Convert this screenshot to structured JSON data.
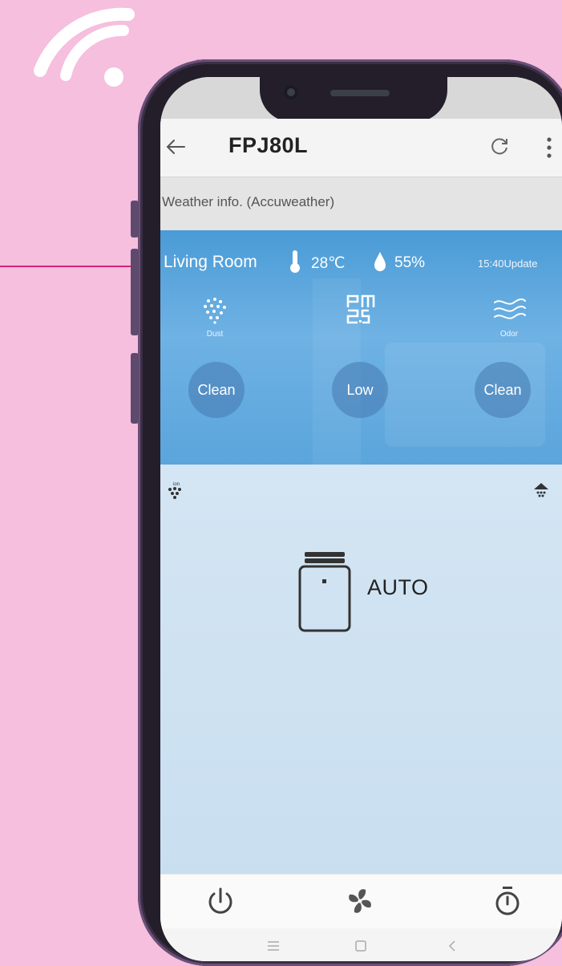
{
  "app": {
    "title": "FPJ80L"
  },
  "weather": {
    "source_label": "Weather info. (Accuweather)"
  },
  "status": {
    "room": "Living Room",
    "temperature": "28℃",
    "humidity": "55%",
    "update": "15:40Update"
  },
  "sensors": [
    {
      "caption": "Dust",
      "level": "Clean",
      "icon": "dust-icon"
    },
    {
      "caption": "",
      "level": "Low",
      "icon": "pm25-icon"
    },
    {
      "caption": "Odor",
      "level": "Clean",
      "icon": "odor-icon"
    }
  ],
  "mode": {
    "label": "AUTO",
    "ion_tag": "ion"
  },
  "controls": [
    "power-icon",
    "fan-icon",
    "timer-icon"
  ],
  "nav": [
    "menu-icon",
    "home-icon",
    "back-icon"
  ],
  "colors": {
    "background": "#f5bfdd",
    "accent_line": "#d4237c",
    "panel_blue": "#5aa5dc",
    "phone_frame": "#231e2a"
  }
}
